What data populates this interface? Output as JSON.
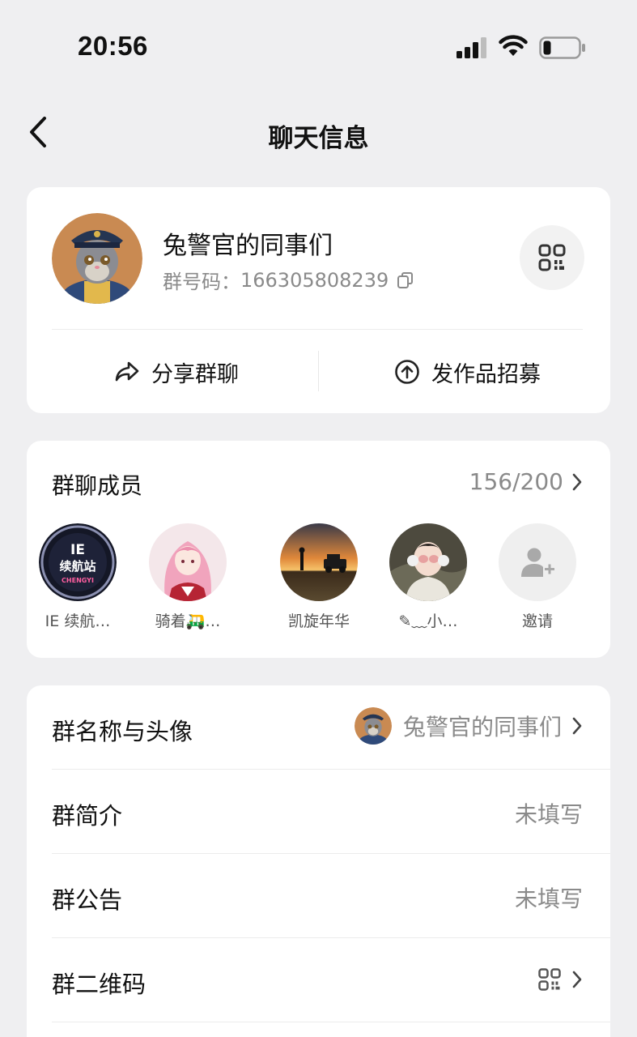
{
  "status": {
    "time": "20:56"
  },
  "nav": {
    "title": "聊天信息"
  },
  "group": {
    "name": "兔警官的同事们",
    "id_label": "群号码：",
    "id": "166305808239",
    "share_label": "分享群聊",
    "recruit_label": "发作品招募"
  },
  "members": {
    "title": "群聊成员",
    "count": "156/200",
    "list": [
      {
        "name": "IE 续航…",
        "avatar_text": "IE\n续航站"
      },
      {
        "name": "骑着🛺…"
      },
      {
        "name": "凯旋年华"
      },
      {
        "name": "✎﹏小…"
      },
      {
        "name": "邀请"
      }
    ],
    "ie_badge_top": "IE",
    "ie_badge_mid": "续航站",
    "ie_badge_bottom": "CHENGYI"
  },
  "settings": [
    {
      "label": "群名称与头像",
      "value": "兔警官的同事们"
    },
    {
      "label": "群简介",
      "value": "未填写"
    },
    {
      "label": "群公告",
      "value": "未填写"
    },
    {
      "label": "群二维码",
      "value": ""
    }
  ],
  "colors": {
    "background": "#efeff1",
    "card": "#ffffff",
    "secondary_text": "#8a8a8a"
  }
}
